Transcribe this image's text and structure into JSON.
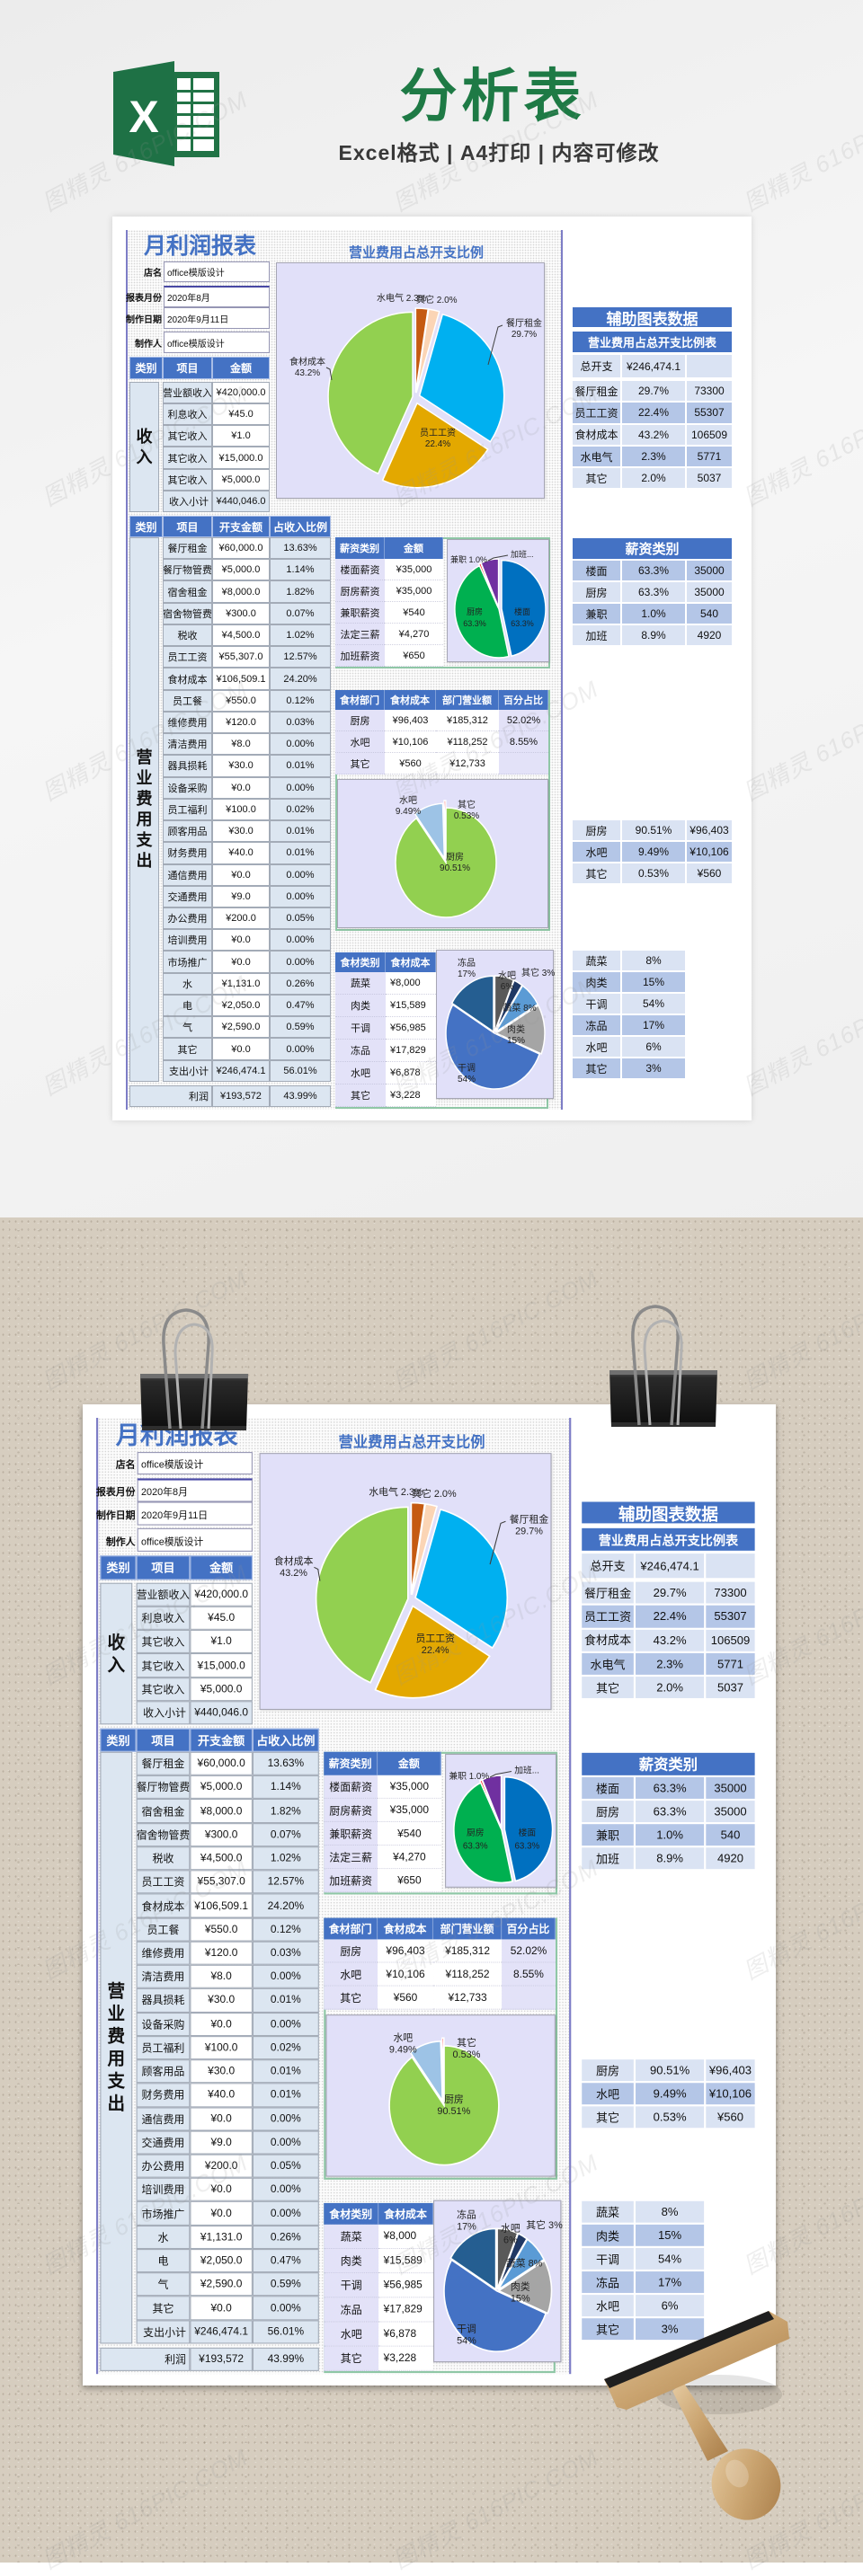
{
  "header": {
    "logo_letter": "X",
    "title": "分析表",
    "subtitle": "Excel格式 | A4打印 | 内容可修改",
    "title_color": "#1e7a45"
  },
  "watermark": "图精灵 616PIC.COM",
  "colors": {
    "accent": "#4472c4",
    "chart_background": "#e1e0f9",
    "aux_row_light": "#dae3f3",
    "aux_row_dark": "#b4c6e7",
    "label_cell": "#dce6f1"
  },
  "report": {
    "title": "月利润报表",
    "info": [
      {
        "label": "店名",
        "value": "office模版设计"
      },
      {
        "label": "报表月份",
        "value": "2020年8月"
      },
      {
        "label": "制作日期",
        "value": "2020年9月11日"
      },
      {
        "label": "制作人",
        "value": "office模版设计"
      }
    ],
    "income": {
      "headers": [
        "类别",
        "项目",
        "金额"
      ],
      "category": "收入",
      "rows": [
        {
          "item": "营业额收入",
          "amount": "¥420,000.0"
        },
        {
          "item": "利息收入",
          "amount": "¥45.0"
        },
        {
          "item": "其它收入",
          "amount": "¥1.0"
        },
        {
          "item": "其它收入",
          "amount": "¥15,000.0"
        },
        {
          "item": "其它收入",
          "amount": "¥5,000.0"
        }
      ],
      "subtotal": {
        "label": "收入小计",
        "amount": "¥440,046.0"
      }
    },
    "expense": {
      "headers": [
        "类别",
        "项目",
        "开支金额",
        "占收入比例"
      ],
      "category": "营业费用支出",
      "rows": [
        {
          "item": "餐厅租金",
          "amount": "¥60,000.0",
          "ratio": "13.63%"
        },
        {
          "item": "餐厅物管费",
          "amount": "¥5,000.0",
          "ratio": "1.14%"
        },
        {
          "item": "宿舍租金",
          "amount": "¥8,000.0",
          "ratio": "1.82%"
        },
        {
          "item": "宿舍物管费",
          "amount": "¥300.0",
          "ratio": "0.07%"
        },
        {
          "item": "税收",
          "amount": "¥4,500.0",
          "ratio": "1.02%"
        },
        {
          "item": "员工工资",
          "amount": "¥55,307.0",
          "ratio": "12.57%"
        },
        {
          "item": "食材成本",
          "amount": "¥106,509.1",
          "ratio": "24.20%"
        },
        {
          "item": "员工餐",
          "amount": "¥550.0",
          "ratio": "0.12%"
        },
        {
          "item": "维修费用",
          "amount": "¥120.0",
          "ratio": "0.03%"
        },
        {
          "item": "清洁费用",
          "amount": "¥8.0",
          "ratio": "0.00%"
        },
        {
          "item": "器具损耗",
          "amount": "¥30.0",
          "ratio": "0.01%"
        },
        {
          "item": "设备采购",
          "amount": "¥0.0",
          "ratio": "0.00%"
        },
        {
          "item": "员工福利",
          "amount": "¥100.0",
          "ratio": "0.02%"
        },
        {
          "item": "顾客用品",
          "amount": "¥30.0",
          "ratio": "0.01%"
        },
        {
          "item": "财务费用",
          "amount": "¥40.0",
          "ratio": "0.01%"
        },
        {
          "item": "通信费用",
          "amount": "¥0.0",
          "ratio": "0.00%"
        },
        {
          "item": "交通费用",
          "amount": "¥9.0",
          "ratio": "0.00%"
        },
        {
          "item": "办公费用",
          "amount": "¥200.0",
          "ratio": "0.05%"
        },
        {
          "item": "培训费用",
          "amount": "¥0.0",
          "ratio": "0.00%"
        },
        {
          "item": "市场推广",
          "amount": "¥0.0",
          "ratio": "0.00%"
        },
        {
          "item": "水",
          "amount": "¥1,131.0",
          "ratio": "0.26%"
        },
        {
          "item": "电",
          "amount": "¥2,050.0",
          "ratio": "0.47%"
        },
        {
          "item": "气",
          "amount": "¥2,590.0",
          "ratio": "0.59%"
        },
        {
          "item": "其它",
          "amount": "¥0.0",
          "ratio": "0.00%"
        }
      ],
      "subtotal": {
        "label": "支出小计",
        "amount": "¥246,474.1",
        "ratio": "56.01%"
      }
    },
    "profit": {
      "label": "利润",
      "amount": "¥193,572",
      "ratio": "43.99%"
    }
  },
  "tables": {
    "salary": {
      "headers": [
        "薪资类别",
        "金额"
      ],
      "rows": [
        {
          "name": "楼面薪资",
          "amount": "¥35,000"
        },
        {
          "name": "厨房薪资",
          "amount": "¥35,000"
        },
        {
          "name": "兼职薪资",
          "amount": "¥540"
        },
        {
          "name": "法定三薪",
          "amount": "¥4,270"
        },
        {
          "name": "加班薪资",
          "amount": "¥650"
        }
      ]
    },
    "food_dept": {
      "headers": [
        "食材部门",
        "食材成本",
        "部门营业额",
        "百分占比"
      ],
      "rows": [
        {
          "dept": "厨房",
          "cost": "¥96,403",
          "revenue": "¥185,312",
          "ratio": "52.02%"
        },
        {
          "dept": "水吧",
          "cost": "¥10,106",
          "revenue": "¥118,252",
          "ratio": "8.55%"
        },
        {
          "dept": "其它",
          "cost": "¥560",
          "revenue": "¥12,733",
          "ratio": ""
        }
      ]
    },
    "food_category": {
      "headers": [
        "食材类别",
        "食材成本"
      ],
      "rows": [
        {
          "name": "蔬菜",
          "cost": "¥8,000"
        },
        {
          "name": "肉类",
          "cost": "¥15,589"
        },
        {
          "name": "干调",
          "cost": "¥56,985"
        },
        {
          "name": "冻品",
          "cost": "¥17,829"
        },
        {
          "name": "水吧",
          "cost": "¥6,878"
        },
        {
          "name": "其它",
          "cost": "¥3,228"
        }
      ]
    }
  },
  "aux": {
    "title": "辅助图表数据",
    "expense_ratio": {
      "title": "营业费用占总开支比例表",
      "total": {
        "label": "总开支",
        "value": "¥246,474.1",
        "extra": ""
      },
      "rows": [
        {
          "name": "餐厅租金",
          "pct": "29.7%",
          "value": "73300"
        },
        {
          "name": "员工工资",
          "pct": "22.4%",
          "value": "55307"
        },
        {
          "name": "食材成本",
          "pct": "43.2%",
          "value": "106509"
        },
        {
          "name": "水电气",
          "pct": "2.3%",
          "value": "5771"
        },
        {
          "name": "其它",
          "pct": "2.0%",
          "value": "5037"
        }
      ]
    },
    "salary": {
      "title": "薪资类别",
      "rows": [
        {
          "name": "楼面",
          "pct": "63.3%",
          "value": "35000"
        },
        {
          "name": "厨房",
          "pct": "63.3%",
          "value": "35000"
        },
        {
          "name": "兼职",
          "pct": "1.0%",
          "value": "540"
        },
        {
          "name": "加班",
          "pct": "8.9%",
          "value": "4920"
        }
      ]
    },
    "food_dept": {
      "rows": [
        {
          "name": "厨房",
          "pct": "90.51%",
          "value": "¥96,403"
        },
        {
          "name": "水吧",
          "pct": "9.49%",
          "value": "¥10,106"
        },
        {
          "name": "其它",
          "pct": "0.53%",
          "value": "¥560"
        }
      ]
    },
    "food_category": {
      "rows": [
        {
          "name": "蔬菜",
          "pct": "8%"
        },
        {
          "name": "肉类",
          "pct": "15%"
        },
        {
          "name": "干调",
          "pct": "54%"
        },
        {
          "name": "冻品",
          "pct": "17%"
        },
        {
          "name": "水吧",
          "pct": "6%"
        },
        {
          "name": "其它",
          "pct": "3%"
        }
      ]
    }
  },
  "chart_data": [
    {
      "type": "pie",
      "title": "营业费用占总开支比例",
      "categories": [
        "水电气",
        "其它",
        "餐厅租金",
        "员工工资",
        "食材成本"
      ],
      "values": [
        5771,
        5037,
        73300,
        55307,
        106509
      ],
      "colors": [
        "#c55a11",
        "#fbd5b5",
        "#00b0f0",
        "#e3a800",
        "#92d050"
      ],
      "labels": [
        {
          "name": "水电气",
          "value": "2.3%"
        },
        {
          "name": "其它",
          "value": "2.0%"
        },
        {
          "name": "餐厅租金",
          "value": "29.7%"
        },
        {
          "name": "员工工资",
          "value": "22.4%"
        },
        {
          "name": "食材成本",
          "value": "43.2%"
        }
      ],
      "legend": "none"
    },
    {
      "type": "pie",
      "title": "",
      "categories": [
        "楼面",
        "厨房",
        "兼职",
        "加班"
      ],
      "values": [
        35000,
        35000,
        540,
        4920
      ],
      "colors": [
        "#0070c0",
        "#00b050",
        "#ff0000",
        "#7030a0"
      ],
      "labels": [
        {
          "name": "楼面",
          "value": "63.3%"
        },
        {
          "name": "厨房",
          "value": "63.3%"
        },
        {
          "name": "兼职",
          "value": "1.0%"
        },
        {
          "name": "加班...",
          "value": ""
        }
      ],
      "legend": "none"
    },
    {
      "type": "pie",
      "title": "",
      "categories": [
        "厨房",
        "水吧",
        "其它"
      ],
      "values": [
        90.51,
        9.49,
        0.53
      ],
      "colors": [
        "#92d050",
        "#9dc3e6",
        "#ff0000"
      ],
      "labels": [
        {
          "name": "厨房",
          "value": "90.51%"
        },
        {
          "name": "水吧",
          "value": "9.49%"
        },
        {
          "name": "其它",
          "value": "0.53%"
        }
      ],
      "legend": "none"
    },
    {
      "type": "pie",
      "title": "",
      "categories": [
        "水吧",
        "其它",
        "蔬菜",
        "肉类",
        "干调",
        "冻品"
      ],
      "values": [
        6878,
        3228,
        8000,
        15589,
        56985,
        17829
      ],
      "colors": [
        "#595959",
        "#203864",
        "#5b9bd5",
        "#a5a5a5",
        "#4472c4",
        "#255e91"
      ],
      "labels": [
        {
          "name": "水吧",
          "value": "6%"
        },
        {
          "name": "其它",
          "value": "3%"
        },
        {
          "name": "蔬菜",
          "value": "8%"
        },
        {
          "name": "肉类",
          "value": "15%"
        },
        {
          "name": "干调",
          "value": "54%"
        },
        {
          "name": "冻品",
          "value": "17%"
        }
      ],
      "legend": "none"
    }
  ]
}
